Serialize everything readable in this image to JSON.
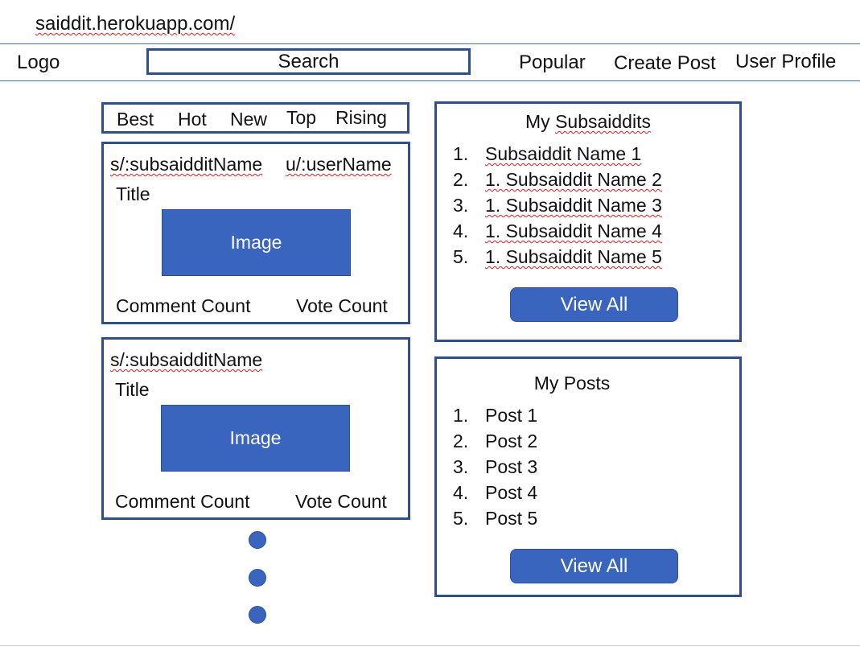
{
  "browser": {
    "url": "saiddit.herokuapp.com/"
  },
  "header": {
    "logo": "Logo",
    "search_label": "Search",
    "nav": {
      "popular": "Popular",
      "create_post": "Create Post",
      "user_profile": "User Profile"
    }
  },
  "sort_tabs": [
    "Best",
    "Hot",
    "New",
    "Top",
    "Rising"
  ],
  "posts": [
    {
      "subsaiddit": "s/:subsaidditName",
      "user": "u/:userName",
      "title": "Title",
      "image_label": "Image",
      "comment_count_label": "Comment Count",
      "vote_count_label": "Vote Count"
    },
    {
      "subsaiddit": "s/:subsaidditName",
      "title": "Title",
      "image_label": "Image",
      "comment_count_label": "Comment Count",
      "vote_count_label": "Vote Count"
    }
  ],
  "my_subsaiddits": {
    "title": "My Subsaiddits",
    "items": [
      {
        "num": "1.",
        "text": "Subsaiddit Name 1"
      },
      {
        "num": "2.",
        "text": "1. Subsaiddit Name 2"
      },
      {
        "num": "3.",
        "text": "1. Subsaiddit Name 3"
      },
      {
        "num": "4.",
        "text": "1. Subsaiddit Name 4"
      },
      {
        "num": "5.",
        "text": "1. Subsaiddit Name 5"
      }
    ],
    "button": "View All"
  },
  "my_posts": {
    "title": "My Posts",
    "items": [
      {
        "num": "1.",
        "text": "Post 1"
      },
      {
        "num": "2.",
        "text": "Post 2"
      },
      {
        "num": "3.",
        "text": "Post 3"
      },
      {
        "num": "4.",
        "text": "Post 4"
      },
      {
        "num": "5.",
        "text": "Post 5"
      }
    ],
    "button": "View All"
  }
}
